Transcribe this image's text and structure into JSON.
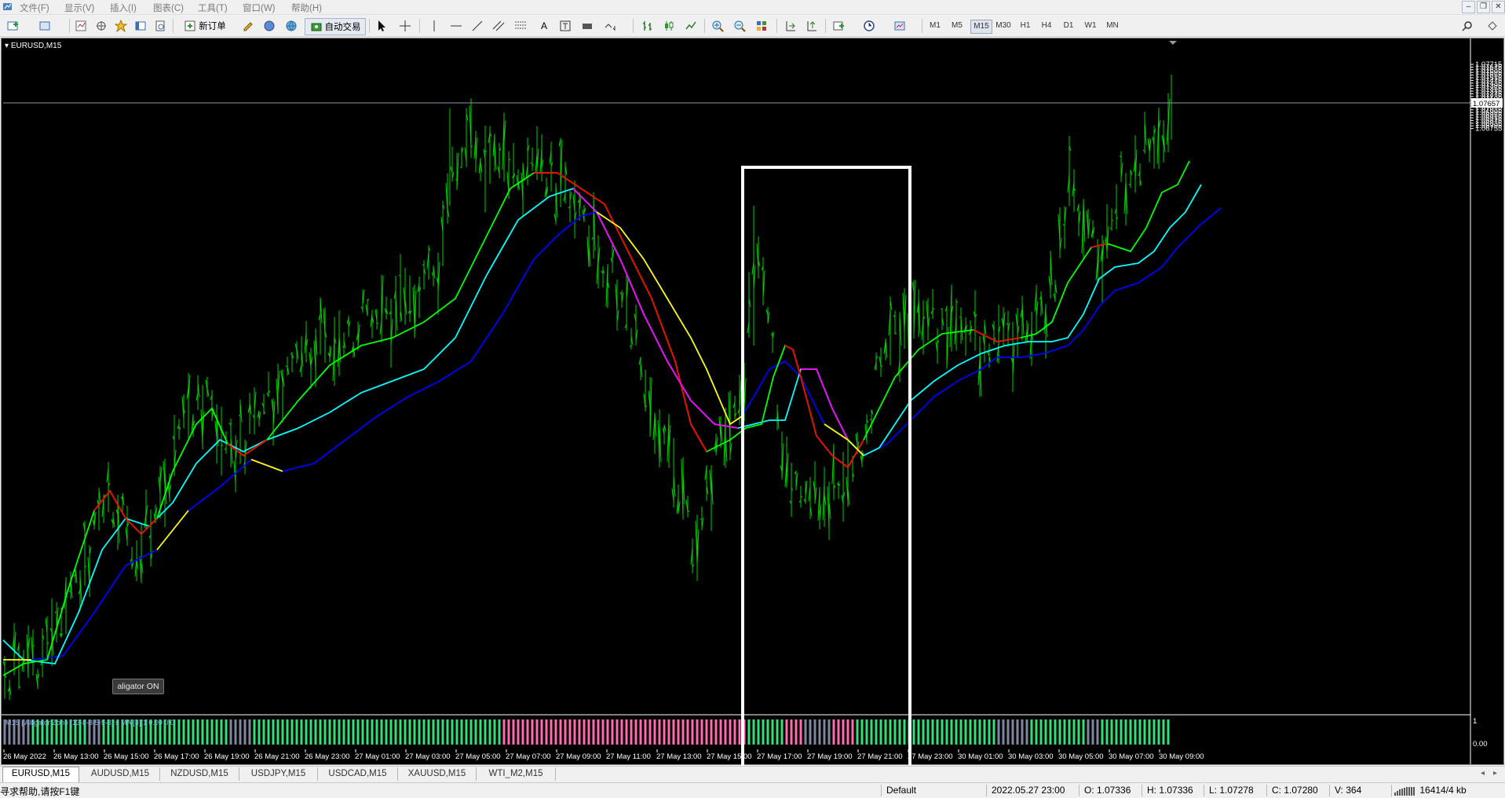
{
  "menu": [
    "文件(F)",
    "显示(V)",
    "插入(I)",
    "图表(C)",
    "工具(T)",
    "窗口(W)",
    "帮助(H)"
  ],
  "toolbar": {
    "new_order": "新订单",
    "auto_trading": "自动交易",
    "text_tool": "A",
    "timeframes": [
      "M1",
      "M5",
      "M15",
      "M30",
      "H1",
      "H4",
      "D1",
      "W1",
      "MN"
    ],
    "active_timeframe": "M15"
  },
  "chart": {
    "title": "EURUSD,M15",
    "symbol": "EURUSD",
    "timeframe": "M15",
    "current_price_label": "1.07657",
    "price_ticks": [
      "1.07715",
      "1.07675",
      "1.07635",
      "1.07595",
      "1.07555",
      "1.07515",
      "1.07475",
      "1.07435",
      "1.07395",
      "1.07355",
      "1.07315",
      "1.07275",
      "1.07235",
      "1.07195",
      "1.07155",
      "1.07115",
      "1.07075",
      "1.07035",
      "1.06995",
      "1.06955",
      "1.06915",
      "1.06875",
      "1.06835",
      "1.06795",
      "1.06755"
    ],
    "time_ticks": [
      "26 May 2022",
      "26 May 13:00",
      "26 May 15:00",
      "26 May 17:00",
      "26 May 19:00",
      "26 May 21:00",
      "26 May 23:00",
      "27 May 01:00",
      "27 May 03:00",
      "27 May 05:00",
      "27 May 07:00",
      "27 May 09:00",
      "27 May 11:00",
      "27 May 13:00",
      "27 May 15:00",
      "27 May 17:00",
      "27 May 19:00",
      "27 May 21:00",
      "27 May 23:00",
      "30 May 01:00",
      "30 May 03:00",
      "30 May 05:00",
      "30 May 07:00",
      "30 May 09:00"
    ],
    "aligator_button": "aligator ON",
    "indicator_label": "M15 | Alligator Zone [13-8-8-5-5-3] s MA [3] 1 0.00 0.0",
    "indicator_scale_top": "1",
    "indicator_scale_bottom": "0.00",
    "colors": {
      "background": "#000000",
      "bars": "#00d000",
      "jaw": "#0000ff",
      "teeth": "#00ffff",
      "lips": "#00ff00",
      "down_cross": "#ff0000",
      "magenta": "#ff00ff",
      "yellow": "#ffff00",
      "zone_green": "#33e07a",
      "zone_grey": "#7f86a0",
      "zone_pink": "#ff6ab0",
      "highlight_box": "#ffffff"
    }
  },
  "tabs": [
    "EURUSD,M15",
    "AUDUSD,M15",
    "NZDUSD,M15",
    "USDJPY,M15",
    "USDCAD,M15",
    "XAUUSD,M15",
    "WTI_M2,M15"
  ],
  "active_tab": "EURUSD,M15",
  "status": {
    "help": "寻求帮助,请按F1键",
    "profile": "Default",
    "datetime": "2022.05.27 23:00",
    "open": "O: 1.07336",
    "high": "H: 1.07336",
    "low": "L: 1.07278",
    "close": "C: 1.07280",
    "volume": "V: 364",
    "traffic": "16414/4 kb"
  }
}
